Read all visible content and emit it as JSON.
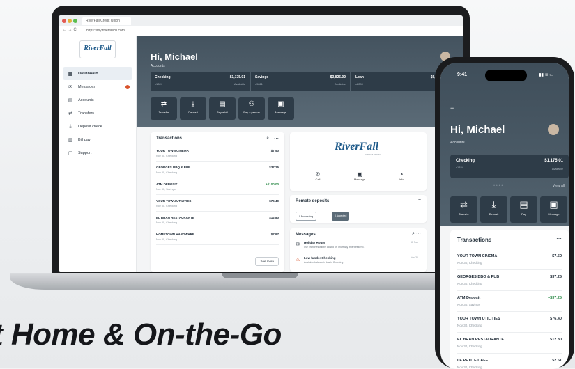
{
  "browser": {
    "tab_title": "RiverFall Credit Union",
    "url": "https://my.riverfallcu.com"
  },
  "brand": {
    "name": "RiverFall",
    "tagline": "CREDIT UNION",
    "accent": "#1e5a8a",
    "hero_color": "#44535f",
    "card_color": "#2e3c48"
  },
  "sidebar": {
    "items": [
      {
        "label": "Dashboard",
        "icon": "dashboard-icon",
        "glyph": "▦"
      },
      {
        "label": "Messages",
        "icon": "mail-icon",
        "glyph": "✉"
      },
      {
        "label": "Accounts",
        "icon": "accounts-icon",
        "glyph": "▤"
      },
      {
        "label": "Transfers",
        "icon": "transfer-icon",
        "glyph": "⇄"
      },
      {
        "label": "Deposit check",
        "icon": "deposit-icon",
        "glyph": "⤓"
      },
      {
        "label": "Bill pay",
        "icon": "bill-icon",
        "glyph": "▥"
      },
      {
        "label": "Support",
        "icon": "support-icon",
        "glyph": "▢"
      }
    ]
  },
  "dashboard": {
    "greeting": "Hi, Michael",
    "sub": "Accounts",
    "accounts": [
      {
        "name": "Checking",
        "amount": "$1,175.01",
        "sub": "x1324",
        "avail": "Available"
      },
      {
        "name": "Savings",
        "amount": "$3,825.00",
        "sub": "x9821",
        "avail": "Available"
      },
      {
        "name": "Loan",
        "amount": "$6,713.00",
        "sub": "x2290",
        "avail": "Balance"
      }
    ],
    "quick_actions": [
      {
        "label": "Transfer",
        "icon": "transfer-icon",
        "glyph": "⇄"
      },
      {
        "label": "Deposit",
        "icon": "deposit-icon",
        "glyph": "⤓"
      },
      {
        "label": "Pay a bill",
        "icon": "bill-icon",
        "glyph": "▤"
      },
      {
        "label": "Pay a person",
        "icon": "person-icon",
        "glyph": "⚇"
      },
      {
        "label": "Message",
        "icon": "chat-icon",
        "glyph": "▣"
      }
    ],
    "transactions_title": "Transactions",
    "transactions": [
      {
        "name": "YOUR TOWN CINEMA",
        "sub": "Nov 30, Checking",
        "amount": "$7.50"
      },
      {
        "name": "GEORGES BBQ & PUB",
        "sub": "Nov 30, Checking",
        "amount": "$37.25"
      },
      {
        "name": "ATM DEPOSIT",
        "sub": "Nov 30, Savings",
        "amount": "+$100.00",
        "credit": true
      },
      {
        "name": "YOUR TOWN UTILITIES",
        "sub": "Nov 30, Checking",
        "amount": "$76.40"
      },
      {
        "name": "EL BRAN RESTAURANTE",
        "sub": "Nov 30, Checking",
        "amount": "$12.80"
      },
      {
        "name": "HOMETOWN HARDWARE",
        "sub": "Nov 30, Checking",
        "amount": "$7.97"
      }
    ],
    "see_more": "See more",
    "contact": [
      {
        "label": "Call",
        "glyph": "✆"
      },
      {
        "label": "Message",
        "glyph": "▣"
      },
      {
        "label": "Info",
        "glyph": "◔"
      }
    ],
    "remote_deposits": {
      "title": "Remote deposits",
      "pills": [
        "0 Processing",
        "0 Accepted"
      ]
    },
    "messages": {
      "title": "Messages",
      "items": [
        {
          "title": "Holiday Hours",
          "desc": "Our branches will be closed on Thursday, this weekend.",
          "date": "30 Nov",
          "glyph": "✉"
        },
        {
          "title": "Low funds: Checking",
          "desc": "Available balance is low in Checking",
          "date": "Nov 26",
          "glyph": "⚠"
        }
      ]
    }
  },
  "phone": {
    "time": "9:41",
    "status": "▮▮ ≋ ▭",
    "greeting": "Hi, Michael",
    "sub": "Accounts",
    "account": {
      "name": "Checking",
      "amount": "$1,175.01",
      "sub": "x1324",
      "avail": "Available"
    },
    "view_all": "View all",
    "quick_actions": [
      {
        "label": "Transfer",
        "glyph": "⇄"
      },
      {
        "label": "Deposit",
        "glyph": "⤓"
      },
      {
        "label": "Pay",
        "glyph": "▤"
      },
      {
        "label": "Message",
        "glyph": "▣"
      }
    ],
    "transactions_title": "Transactions",
    "transactions": [
      {
        "name": "YOUR TOWN CINEMA",
        "sub": "Nov 30, Checking",
        "amount": "$7.50"
      },
      {
        "name": "GEORGES BBQ & PUB",
        "sub": "Nov 30, Checking",
        "amount": "$37.25"
      },
      {
        "name": "ATM Deposit",
        "sub": "Nov 30, Savings",
        "amount": "+$37.25",
        "credit": true
      },
      {
        "name": "YOUR TOWN UTILITIES",
        "sub": "Nov 30, Checking",
        "amount": "$76.40"
      },
      {
        "name": "EL BRAN RESTAURANTE",
        "sub": "Nov 30, Checking",
        "amount": "$12.80"
      },
      {
        "name": "LE PETITE CAFE",
        "sub": "Nov 30, Checking",
        "amount": "$2.51"
      }
    ]
  },
  "headline": "t Home & On-the-Go"
}
